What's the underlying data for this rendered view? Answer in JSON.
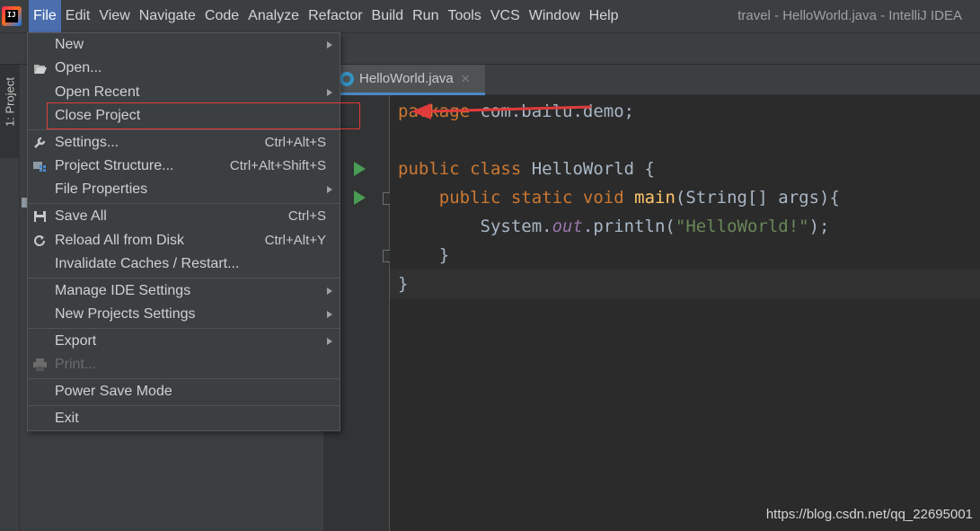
{
  "window_title": "travel - HelloWorld.java - IntelliJ IDEA",
  "menubar": [
    "File",
    "Edit",
    "View",
    "Navigate",
    "Code",
    "Analyze",
    "Refactor",
    "Build",
    "Run",
    "Tools",
    "VCS",
    "Window",
    "Help"
  ],
  "app_logo_text": "IJ",
  "project_tab_label": "1: Project",
  "editor": {
    "tab_label": "HelloWorld.java",
    "tab_close": "✕",
    "lines": [
      {
        "parts": [
          {
            "c": "kw",
            "t": "package"
          },
          {
            "c": "",
            "t": " com.bailu.demo;"
          }
        ]
      },
      {
        "parts": []
      },
      {
        "parts": [
          {
            "c": "kw",
            "t": "public class"
          },
          {
            "c": "",
            "t": " HelloWorld {"
          }
        ]
      },
      {
        "parts": [
          {
            "c": "",
            "t": "    "
          },
          {
            "c": "kw",
            "t": "public static void"
          },
          {
            "c": "",
            "t": " "
          },
          {
            "c": "fn",
            "t": "main"
          },
          {
            "c": "",
            "t": "(String[] args){"
          }
        ]
      },
      {
        "parts": [
          {
            "c": "",
            "t": "        System."
          },
          {
            "c": "it",
            "t": "out"
          },
          {
            "c": "",
            "t": ".println("
          },
          {
            "c": "st",
            "t": "\"HelloWorld!\""
          },
          {
            "c": "",
            "t": ");"
          }
        ]
      },
      {
        "parts": [
          {
            "c": "",
            "t": "    }"
          }
        ]
      },
      {
        "parts": [
          {
            "c": "",
            "t": "}"
          }
        ]
      }
    ]
  },
  "file_menu": {
    "new": "New",
    "open": "Open...",
    "open_recent": "Open Recent",
    "close_project": "Close Project",
    "settings": "Settings...",
    "settings_shortcut": "Ctrl+Alt+S",
    "project_structure": "Project Structure...",
    "project_structure_shortcut": "Ctrl+Alt+Shift+S",
    "file_properties": "File Properties",
    "save_all": "Save All",
    "save_all_shortcut": "Ctrl+S",
    "reload": "Reload All from Disk",
    "reload_shortcut": "Ctrl+Alt+Y",
    "invalidate": "Invalidate Caches / Restart...",
    "manage_ide": "Manage IDE Settings",
    "new_projects_settings": "New Projects Settings",
    "export": "Export",
    "print": "Print...",
    "power_save": "Power Save Mode",
    "exit": "Exit"
  },
  "colors": {
    "accent": "#4b6eaf",
    "highlight_box": "#e03b3b",
    "arrow": "#e03b3b"
  },
  "watermark": "https://blog.csdn.net/qq_22695001"
}
